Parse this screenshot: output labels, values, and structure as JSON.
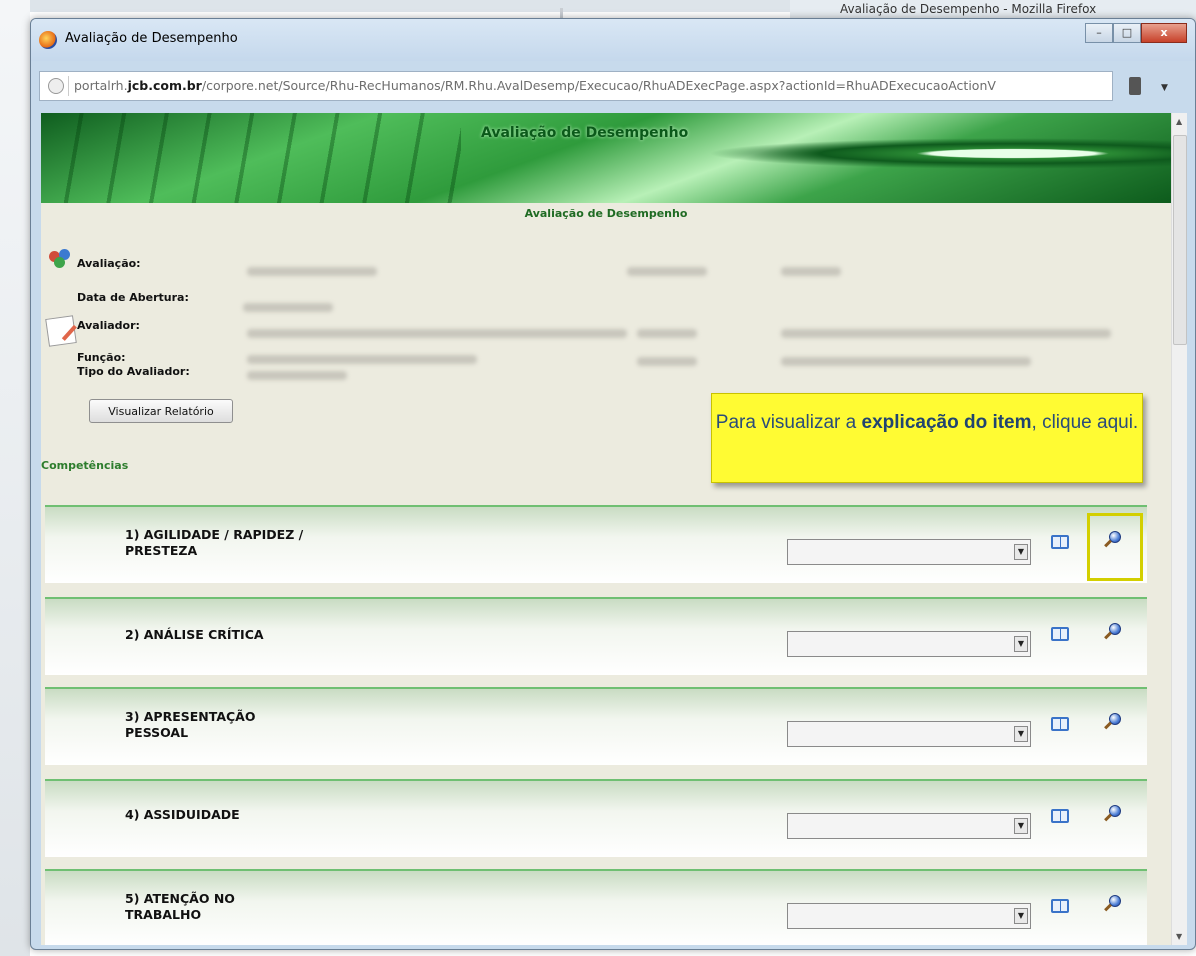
{
  "background": {
    "behind_window_title": "Avaliação de Desempenho - Mozilla Firefox"
  },
  "window": {
    "title": "Avaliação de Desempenho",
    "controls": {
      "minimize": "–",
      "maximize": "□",
      "close": "x"
    }
  },
  "address_bar": {
    "url_prefix": "portalrh.",
    "url_domain": "jcb.com.br",
    "url_path": "/corpore.net/Source/Rhu-RecHumanos/RM.Rhu.AvalDesemp/Execucao/RhuADExecPage.aspx?actionId=RhuADExecucaoActionV"
  },
  "banner": {
    "title": "Avaliação de Desempenho"
  },
  "page": {
    "heading": "Avaliação de Desempenho",
    "labels": {
      "avaliacao": "Avaliação:",
      "data_abertura": "Data de Abertura:",
      "avaliador": "Avaliador:",
      "funcao": "Função:",
      "tipo_avaliador": "Tipo do Avaliador:"
    },
    "report_button": "Visualizar Relatório",
    "section_title": "Competências"
  },
  "callout": {
    "text_1": "Para visualizar a ",
    "bold_1": "explicação do item",
    "text_2": ", clique aqui.",
    "accent_color": "#fffb33"
  },
  "competencies": [
    {
      "name": "1) AGILIDADE / RAPIDEZ / PRESTEZA",
      "selected": ""
    },
    {
      "name": "2) ANÁLISE CRÍTICA",
      "selected": ""
    },
    {
      "name": "3) APRESENTAÇÃO PESSOAL",
      "selected": ""
    },
    {
      "name": "4) ASSIDUIDADE",
      "selected": ""
    },
    {
      "name": "5) ATENÇÃO NO TRABALHO",
      "selected": ""
    }
  ],
  "icons": {
    "book": "book-icon",
    "zoom": "magnifier-icon"
  }
}
